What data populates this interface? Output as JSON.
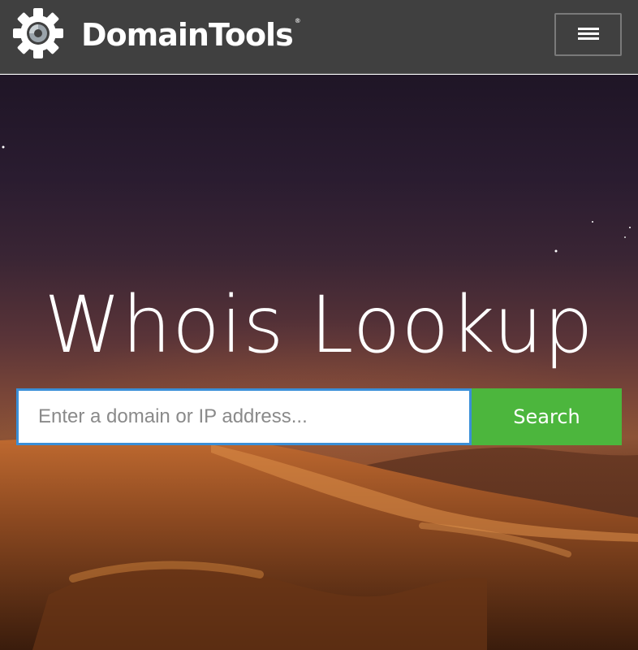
{
  "header": {
    "brand": "DomainTools",
    "brand_mark": "®",
    "logo_icon": "gear-logo-icon",
    "menu_icon": "hamburger-icon"
  },
  "hero": {
    "title": "Whois Lookup",
    "search": {
      "placeholder": "Enter a domain or IP address...",
      "value": "",
      "button_label": "Search"
    }
  },
  "colors": {
    "header_bg": "#404040",
    "search_button": "#4cb63d",
    "input_border": "#3a8fd8"
  }
}
